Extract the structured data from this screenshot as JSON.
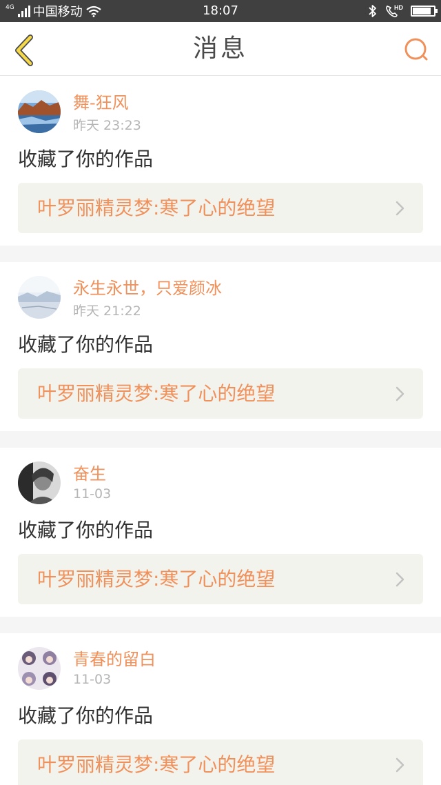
{
  "status_bar": {
    "network_type": "4G",
    "carrier": "中国移动",
    "time": "18:07",
    "battery_level": 0.85,
    "icons": [
      "signal-icon",
      "wifi-icon",
      "bluetooth-icon",
      "hd-call-icon",
      "battery-icon"
    ]
  },
  "header": {
    "title": "消息",
    "back_icon": "chevron-left-icon",
    "search_icon": "search-icon"
  },
  "colors": {
    "accent": "#f0905a",
    "back_icon": "#f5d94a",
    "text_primary": "#333333",
    "text_secondary": "#b5b5b5",
    "card_box": "#f3f3ee",
    "divider": "#f5f5f5"
  },
  "messages": [
    {
      "username": "舞-狂风",
      "time": "昨天 23:23",
      "action": "收藏了你的作品",
      "work_title": "叶罗丽精灵梦:寒了心的绝望",
      "avatar": "landscape-avatar"
    },
    {
      "username": "永生永世，只爱颜冰",
      "time": "昨天 21:22",
      "action": "收藏了你的作品",
      "work_title": "叶罗丽精灵梦:寒了心的绝望",
      "avatar": "snow-avatar"
    },
    {
      "username": "奋生",
      "time": "11-03",
      "action": "收藏了你的作品",
      "work_title": "叶罗丽精灵梦:寒了心的绝望",
      "avatar": "portrait-avatar"
    },
    {
      "username": "青春的留白",
      "time": "11-03",
      "action": "收藏了你的作品",
      "work_title": "叶罗丽精灵梦:寒了心的绝望",
      "avatar": "anime-avatar"
    }
  ]
}
